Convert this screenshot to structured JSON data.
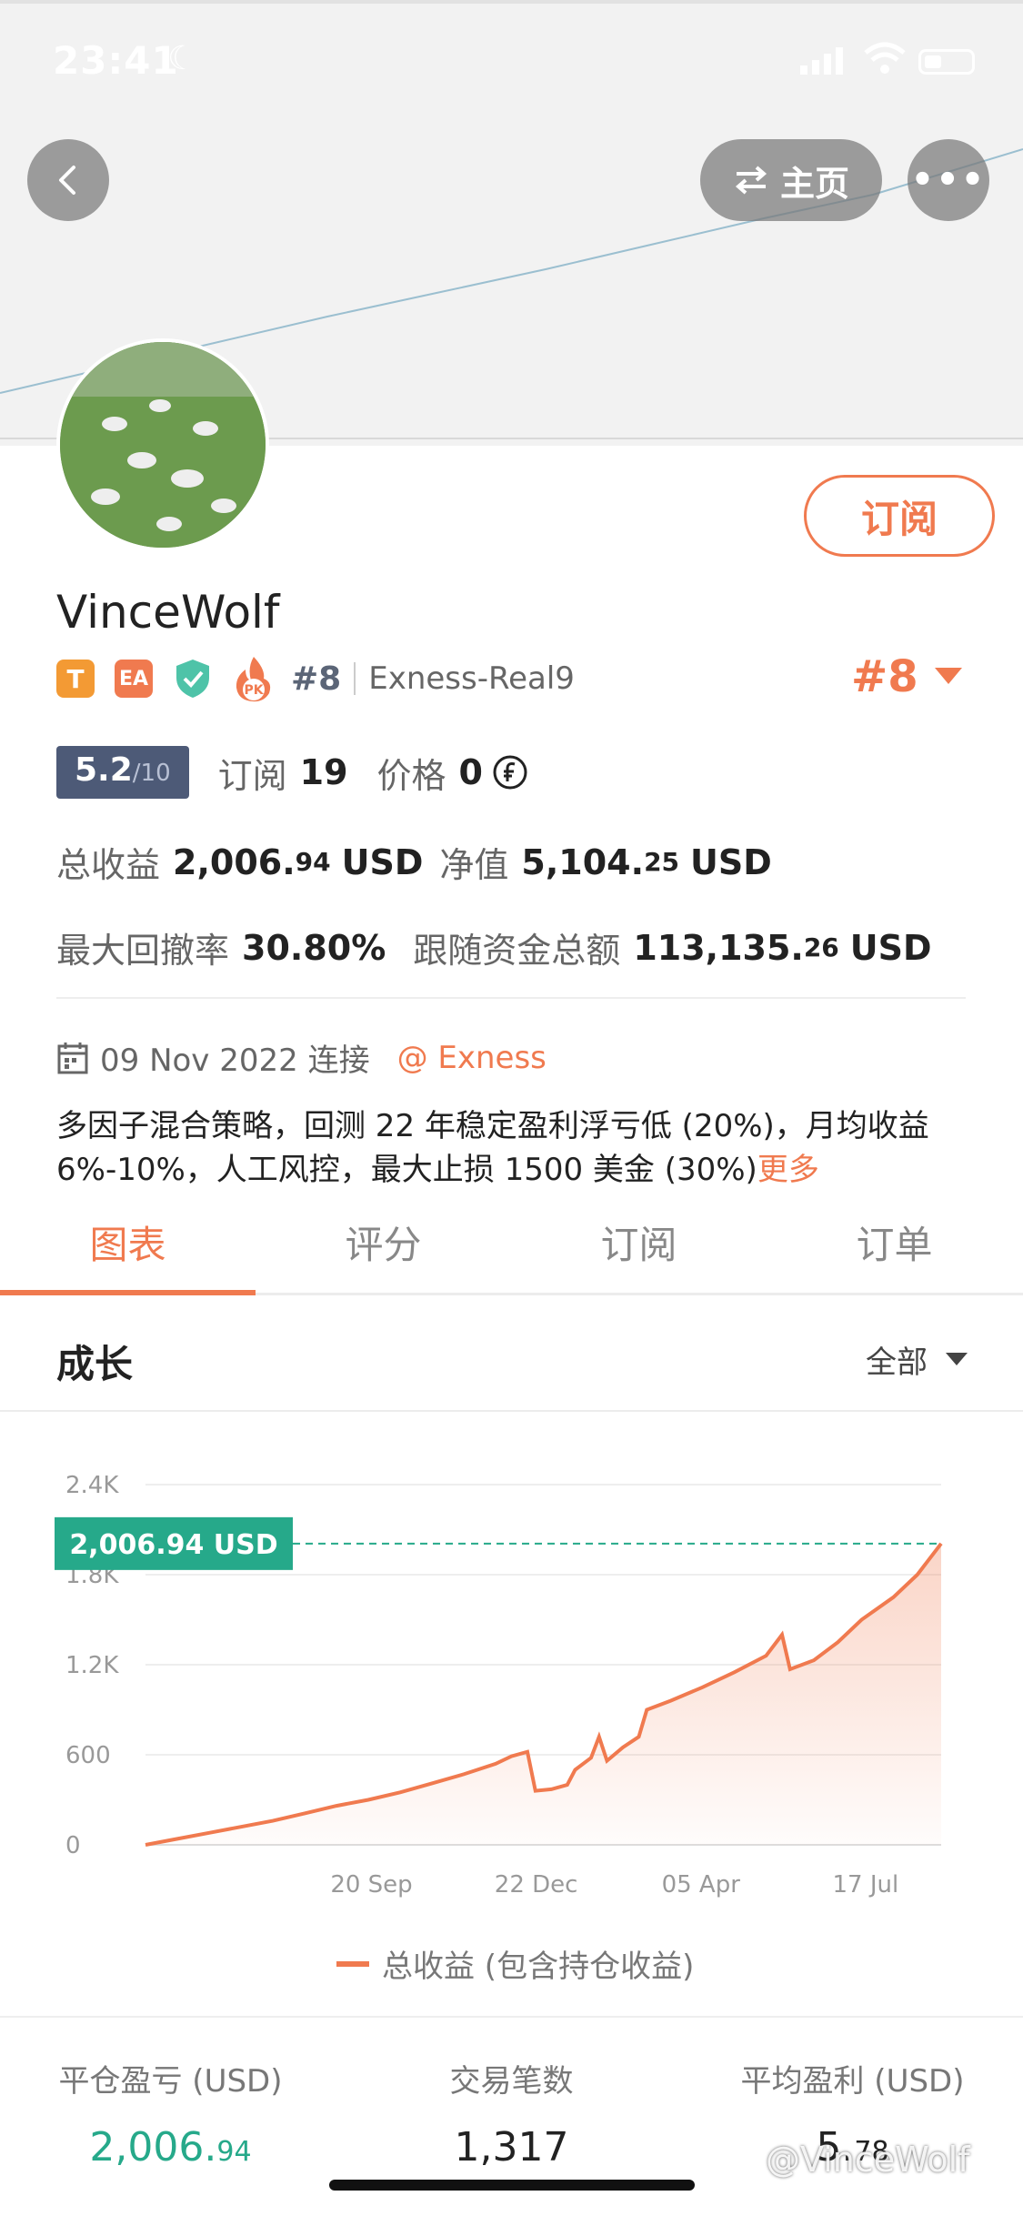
{
  "status": {
    "time": "23:41"
  },
  "nav": {
    "home_label": "主页"
  },
  "profile": {
    "subscribe_label": "订阅",
    "name": "VinceWolf",
    "badges": {
      "t": "T",
      "ea": "EA",
      "pk": "PK"
    },
    "rank_small": "#8",
    "account": "Exness-Real9",
    "rank_big": "#8"
  },
  "metrics": {
    "score": "5.2",
    "score_den": "/10",
    "subs_label": "订阅",
    "subs_value": "19",
    "price_label": "价格",
    "price_value": "0",
    "total_profit_label": "总收益",
    "total_profit_int": "2,006.",
    "total_profit_dec": "94",
    "total_profit_unit": "USD",
    "equity_label": "净值",
    "equity_int": "5,104.",
    "equity_dec": "25",
    "equity_unit": "USD",
    "drawdown_label": "最大回撤率",
    "drawdown_value": "30.80%",
    "follow_label": "跟随资金总额",
    "follow_int": "113,135.",
    "follow_dec": "26",
    "follow_unit": "USD"
  },
  "info": {
    "connect_date": "09 Nov 2022 连接",
    "broker": "@ Exness",
    "description": "多因子混合策略，回测 22 年稳定盈利浮亏低 (20%)，月均收益 6%-10%，人工风控，最大止损 1500 美金 (30%)",
    "more": "更多"
  },
  "tabs": [
    "图表",
    "评分",
    "订阅",
    "订单"
  ],
  "growth": {
    "title": "成长",
    "filter": "全部"
  },
  "chart_data": {
    "type": "area",
    "y_ticks": [
      "2.4K",
      "1.8K",
      "1.2K",
      "600",
      "0"
    ],
    "x_ticks": [
      "20 Sep",
      "22 Dec",
      "05 Apr",
      "17 Jul"
    ],
    "ylim": [
      0,
      2400
    ],
    "current_label": "2,006.94 USD",
    "current_value": 2006.94,
    "legend": "总收益 (包含持仓收益)",
    "series": [
      {
        "name": "总收益 (包含持仓收益)",
        "points": [
          [
            0,
            0
          ],
          [
            4,
            40
          ],
          [
            8,
            80
          ],
          [
            12,
            120
          ],
          [
            16,
            160
          ],
          [
            20,
            210
          ],
          [
            24,
            260
          ],
          [
            28,
            300
          ],
          [
            32,
            350
          ],
          [
            36,
            410
          ],
          [
            40,
            470
          ],
          [
            44,
            540
          ],
          [
            46,
            590
          ],
          [
            48,
            620
          ],
          [
            49,
            360
          ],
          [
            51,
            370
          ],
          [
            53,
            400
          ],
          [
            54,
            500
          ],
          [
            56,
            580
          ],
          [
            57,
            720
          ],
          [
            58,
            560
          ],
          [
            60,
            650
          ],
          [
            62,
            720
          ],
          [
            63,
            900
          ],
          [
            66,
            960
          ],
          [
            70,
            1050
          ],
          [
            74,
            1150
          ],
          [
            78,
            1260
          ],
          [
            80,
            1400
          ],
          [
            81,
            1170
          ],
          [
            84,
            1230
          ],
          [
            87,
            1350
          ],
          [
            90,
            1500
          ],
          [
            94,
            1650
          ],
          [
            97,
            1800
          ],
          [
            100,
            2007
          ]
        ]
      }
    ]
  },
  "stats": [
    {
      "label": "平仓盈亏 (USD)",
      "int": "2,006.",
      "dec": "94"
    },
    {
      "label": "交易笔数",
      "int": "1,317",
      "dec": ""
    },
    {
      "label": "平均盈利 (USD)",
      "int": "5.",
      "dec": "78"
    }
  ],
  "watermark": "@VinceWolf",
  "colors": {
    "accent": "#f07a4f",
    "green": "#26a98a",
    "score_bg": "#4d5a77"
  }
}
